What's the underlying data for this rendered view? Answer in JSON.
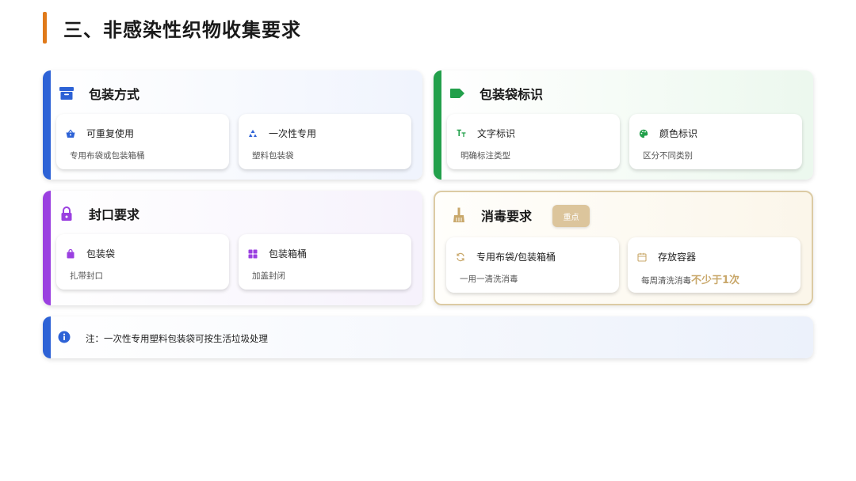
{
  "page": {
    "title": "三、非感染性织物收集要求"
  },
  "colors": {
    "title_accent": "#e07a1a",
    "blue": "#2d62d6",
    "green": "#22a04b",
    "purple": "#9a3fe0",
    "gold": "#c9a86b"
  },
  "packaging": {
    "title": "包装方式",
    "icon": "archive-box-icon",
    "items": [
      {
        "icon": "basket-icon",
        "title": "可重复使用",
        "desc": "专用布袋或包装箱桶"
      },
      {
        "icon": "recycle-icon",
        "title": "一次性专用",
        "desc": "塑料包装袋"
      }
    ]
  },
  "labeling": {
    "title": "包装袋标识",
    "icon": "tag-icon",
    "items": [
      {
        "icon": "text-format-icon",
        "title": "文字标识",
        "desc": "明确标注类型"
      },
      {
        "icon": "palette-icon",
        "title": "颜色标识",
        "desc": "区分不同类别"
      }
    ]
  },
  "sealing": {
    "title": "封口要求",
    "icon": "lock-icon",
    "items": [
      {
        "icon": "bag-icon",
        "title": "包装袋",
        "desc": "扎带封口"
      },
      {
        "icon": "grid-box-icon",
        "title": "包装箱桶",
        "desc": "加盖封闭"
      }
    ]
  },
  "disinfection": {
    "title": "消毒要求",
    "icon": "broom-icon",
    "badge": "重点",
    "items": [
      {
        "icon": "sync-icon",
        "title": "专用布袋/包装箱桶",
        "desc": "一用一清洗消毒"
      },
      {
        "icon": "calendar-icon",
        "title": "存放容器",
        "desc": "每周清洗消毒",
        "highlight": "不少于1次"
      }
    ]
  },
  "note": {
    "icon": "info-icon",
    "text": "注：一次性专用塑料包装袋可按生活垃圾处理"
  }
}
